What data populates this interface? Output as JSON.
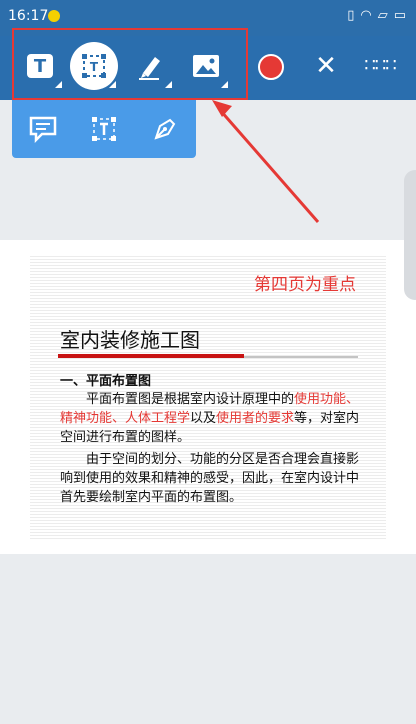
{
  "status": {
    "time": "16:17"
  },
  "toolbar": {
    "text_tool_glyph": "T",
    "frame_tool_glyph": "T"
  },
  "document": {
    "emphasis": "第四页为重点",
    "title": "室内装修施工图",
    "section": "一、平面布置图",
    "para1": [
      {
        "text": "平面布置图是根据室内设计原理中的",
        "red": false
      },
      {
        "text": "使用功能、精神功能、人体工程学",
        "red": true
      },
      {
        "text": "以及",
        "red": false
      },
      {
        "text": "使用者的要求",
        "red": true
      },
      {
        "text": "等，对室内空间进行布置的图样。",
        "red": false
      }
    ],
    "para2": "由于空间的划分、功能的分区是否合理会直接影响到使用的效果和精神的感受，因此，在室内设计中首先要绘制室内平面的布置图。"
  },
  "colors": {
    "toolbar_bg": "#2a6eae",
    "accent_red": "#e53935",
    "subbar_bg": "#4a9be8"
  }
}
